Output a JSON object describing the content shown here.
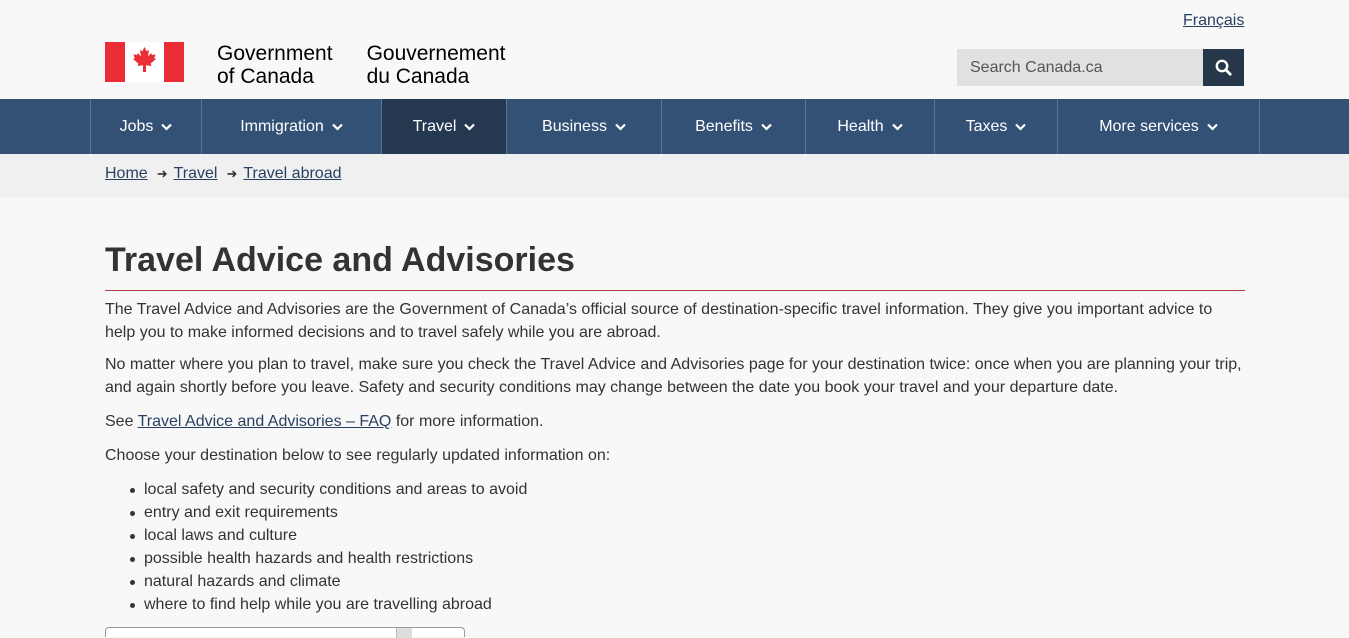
{
  "header": {
    "language_link": "Français",
    "brand_en_line1": "Government",
    "brand_en_line2": "of Canada",
    "brand_fr_line1": "Gouvernement",
    "brand_fr_line2": "du Canada",
    "search_placeholder": "Search Canada.ca",
    "flag_color": "#eb2d37"
  },
  "nav": {
    "items": [
      {
        "label": "Jobs"
      },
      {
        "label": "Immigration"
      },
      {
        "label": "Travel"
      },
      {
        "label": "Business"
      },
      {
        "label": "Benefits"
      },
      {
        "label": "Health"
      },
      {
        "label": "Taxes"
      },
      {
        "label": "More services"
      }
    ],
    "active": "Travel"
  },
  "breadcrumb": {
    "items": [
      "Home",
      "Travel",
      "Travel abroad"
    ]
  },
  "main": {
    "title": "Travel Advice and Advisories",
    "para1": "The Travel Advice and Advisories are the Government of Canada’s official source of destination-specific travel information. They give you important advice to help you to make informed decisions and to travel safely while you are abroad.",
    "para2": "No matter where you plan to travel, make sure you check the Travel Advice and Advisories page for your destination twice: once when you are planning your trip, and again shortly before you leave. Safety and security conditions may change between the date you book your travel and your departure date.",
    "para3_prefix": "See ",
    "para3_link": "Travel Advice and Advisories – FAQ",
    "para3_suffix": " for more information.",
    "para4": "Choose your destination below to see regularly updated information on:",
    "bullets": [
      "local safety and security conditions and areas to avoid",
      "entry and exit requirements",
      "local laws and culture",
      "possible health hazards and health restrictions",
      "natural hazards and climate",
      "where to find help while you are travelling abroad"
    ]
  }
}
